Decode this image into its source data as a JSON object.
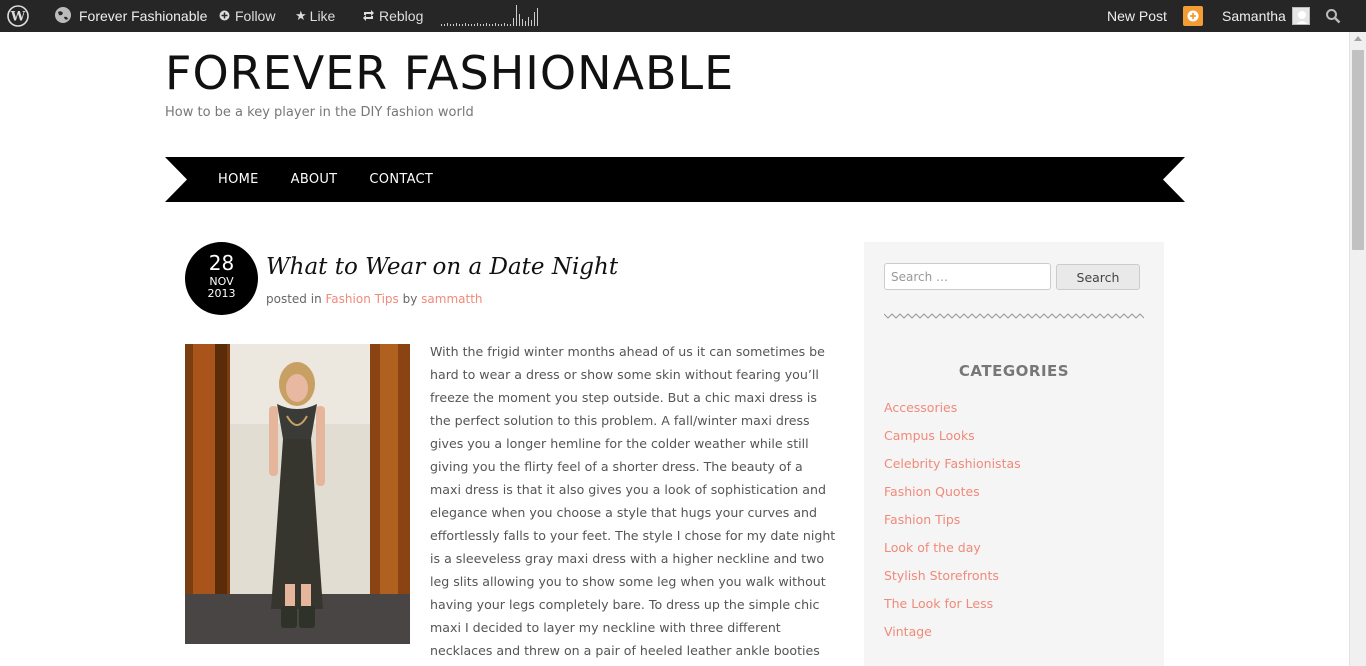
{
  "adminbar": {
    "site_name": "Forever Fashionable",
    "follow_label": "Follow",
    "like_label": "Like",
    "reblog_label": "Reblog",
    "new_post_label": "New Post",
    "user_name": "Samantha"
  },
  "site": {
    "title": "FOREVER FASHIONABLE",
    "tagline": "How to be a key player in the DIY fashion world"
  },
  "nav": {
    "items": [
      {
        "label": "HOME"
      },
      {
        "label": "ABOUT"
      },
      {
        "label": "CONTACT"
      }
    ]
  },
  "post": {
    "date": {
      "day": "28",
      "month": "NOV",
      "year": "2013"
    },
    "title": "What to Wear on a Date Night",
    "meta": {
      "posted_in": "posted in",
      "category": "Fashion Tips",
      "by": "by",
      "author": "sammatth"
    },
    "body_lines": [
      " With the frigid winter months ahead of us it can sometimes be",
      "hard to wear a dress or show  some skin without fearing you’ll",
      "freeze the moment you step outside. But a chic maxi dress is",
      " the perfect solution to this problem. A fall/winter maxi dress",
      "gives you a longer hemline for the  colder weather while still",
      "giving you the flirty feel of  a shorter dress. The beauty of a",
      "maxi  dress is that it also gives you a look of sophistication and",
      "elegance when you choose a style that  hugs your curves and",
      "effortlessly falls to your feet. The style I chose for my date night",
      "is a  sleeveless gray maxi dress with a higher neckline and two",
      "leg slits allowing you to show some  leg when you walk without",
      "having your legs completely bare. To dress up the simple chic",
      "maxi  I decided to layer my neckline with three different",
      "necklaces and threw on a pair of heeled  leather ankle booties"
    ]
  },
  "sidebar": {
    "search": {
      "placeholder": "Search …",
      "button_label": "Search"
    },
    "categories_title": "CATEGORIES",
    "categories": [
      {
        "label": "Accessories"
      },
      {
        "label": "Campus Looks"
      },
      {
        "label": "Celebrity Fashionistas"
      },
      {
        "label": "Fashion Quotes"
      },
      {
        "label": "Fashion Tips"
      },
      {
        "label": "Look of the day"
      },
      {
        "label": "Stylish Storefronts"
      },
      {
        "label": "The Look for Less"
      },
      {
        "label": "Vintage"
      }
    ]
  },
  "colors": {
    "adminbar_bg": "#262626",
    "link_accent": "#f08a7a",
    "nav_bg": "#000000",
    "sidebar_bg": "#f5f5f5",
    "notification": "#f39c34"
  }
}
